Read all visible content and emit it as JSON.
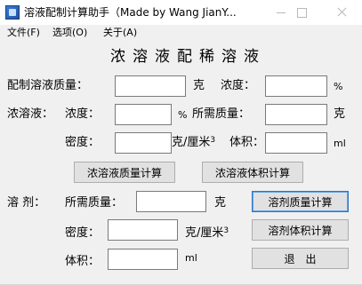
{
  "window": {
    "title": "溶液配制计算助手（Made by Wang JianY..."
  },
  "menu": {
    "items": [
      "文件(F)",
      "选项(O)",
      "关于(A)"
    ]
  },
  "heading": "浓溶液配稀溶液",
  "row_target": {
    "label": "配制溶液质量：",
    "mass_value": "",
    "mass_unit": "克",
    "conc_label": "浓度：",
    "conc_value": "",
    "conc_unit": "%"
  },
  "row_concentrated": {
    "section_label": "浓溶液：",
    "conc_label": "浓度：",
    "conc_value": "",
    "conc_unit": "%",
    "mass_label": "所需质量：",
    "mass_value": "",
    "mass_unit": "克",
    "density_label": "密度：",
    "density_value": "",
    "density_unit": "克/厘米",
    "density_unit_sup": "3",
    "volume_label": "体积：",
    "volume_value": "",
    "volume_unit": "ml"
  },
  "buttons": {
    "calc_conc_mass": "浓溶液质量计算",
    "calc_conc_volume": "浓溶液体积计算",
    "calc_solvent_mass": "溶剂质量计算",
    "calc_solvent_volume": "溶剂体积计算",
    "exit": "退　出"
  },
  "row_solvent": {
    "section_label": "溶 剂：",
    "mass_label": "所需质量：",
    "mass_value": "",
    "mass_unit": "克",
    "density_label": "密度：",
    "density_value": "",
    "density_unit": "克/厘米",
    "density_unit_sup": "3",
    "volume_label": "体积：",
    "volume_value": "",
    "volume_unit": "ml"
  },
  "colors": {
    "window_bg": "#f0f0f0",
    "titlebar_bg": "#ffffff",
    "field_border": "#7a7a7a",
    "button_bg": "#e1e1e1",
    "focus_border": "#2e74c9"
  }
}
